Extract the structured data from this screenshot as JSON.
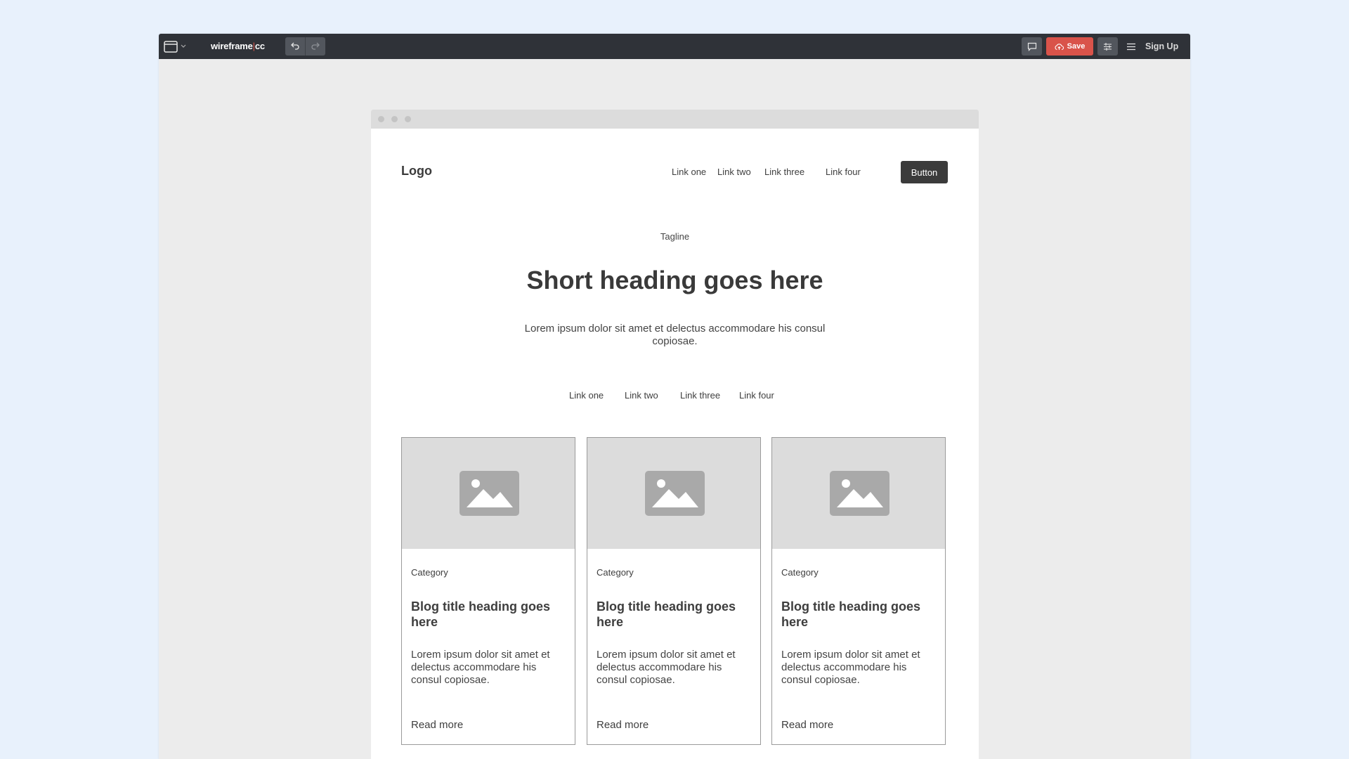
{
  "app": {
    "brand_main": "wireframe",
    "brand_sep": "|",
    "brand_suffix": "cc",
    "save_label": "Save",
    "signup_label": "Sign Up",
    "accent": "#d9534a",
    "topbar_color": "#2f3238",
    "icons": [
      "window-icon",
      "chevron-down-icon",
      "undo-icon",
      "redo-icon",
      "comment-icon",
      "cloud-upload-icon",
      "settings-sliders-icon",
      "menu-icon"
    ]
  },
  "page": {
    "logo": "Logo",
    "nav_links": [
      "Link one",
      "Link two",
      "Link three",
      "Link four"
    ],
    "nav_button": "Button",
    "tagline": "Tagline",
    "heading": "Short heading goes here",
    "lead": "Lorem ipsum dolor sit amet et delectus accommodare his consul copiosae.",
    "sub_links": [
      "Link one",
      "Link two",
      "Link three",
      "Link four"
    ],
    "cards": [
      {
        "category": "Category",
        "title": "Blog title heading goes here",
        "text": "Lorem ipsum dolor sit amet et delectus accommodare his consul copiosae.",
        "read_more": "Read more"
      },
      {
        "category": "Category",
        "title": "Blog title heading goes here",
        "text": "Lorem ipsum dolor sit amet et delectus accommodare his consul copiosae.",
        "read_more": "Read more"
      },
      {
        "category": "Category",
        "title": "Blog title heading goes here",
        "text": "Lorem ipsum dolor sit amet et delectus accommodare his consul copiosae.",
        "read_more": "Read more"
      }
    ]
  }
}
